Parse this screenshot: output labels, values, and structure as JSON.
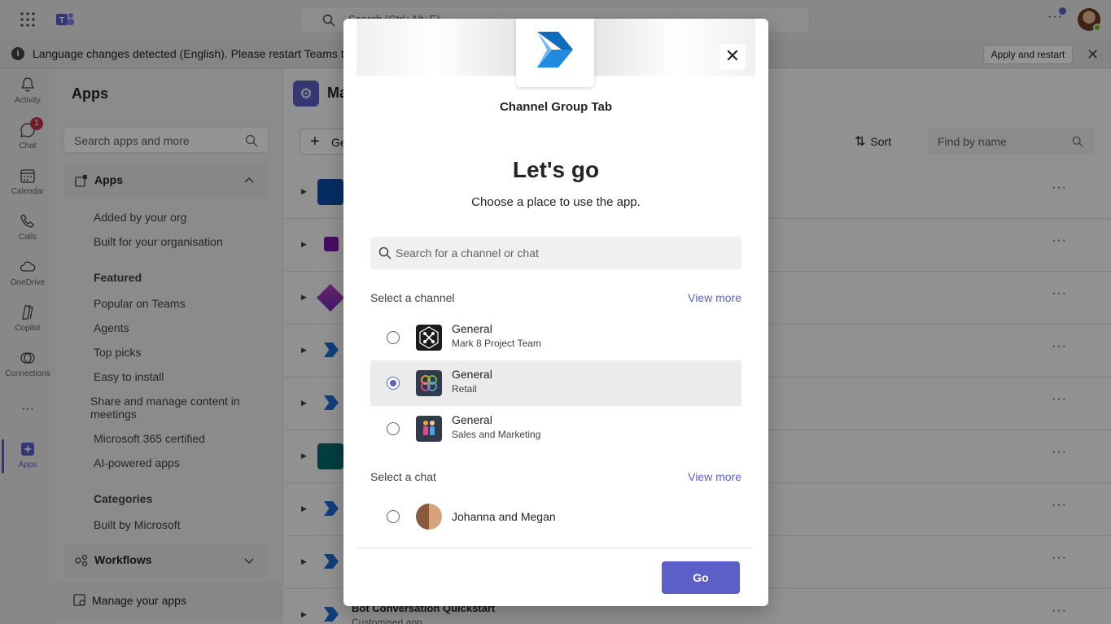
{
  "topbar": {
    "search_placeholder": "Search (Ctrl+Alt+E)",
    "more_label": "···"
  },
  "banner": {
    "text": "Language changes detected (English). Please restart Teams to",
    "apply_label": "Apply and restart",
    "close_label": "✕",
    "info_label": "i"
  },
  "rail": {
    "items": [
      {
        "label": "Activity",
        "icon": "bell-icon"
      },
      {
        "label": "Chat",
        "icon": "chat-icon",
        "badge": "1"
      },
      {
        "label": "Calendar",
        "icon": "calendar-icon"
      },
      {
        "label": "Calls",
        "icon": "phone-icon"
      },
      {
        "label": "OneDrive",
        "icon": "cloud-icon"
      },
      {
        "label": "Copilot",
        "icon": "copilot-icon"
      },
      {
        "label": "Connections",
        "icon": "connections-icon"
      },
      {
        "label": "···",
        "icon": "more-icon"
      },
      {
        "label": "Apps",
        "icon": "apps-icon"
      }
    ]
  },
  "left": {
    "title": "Apps",
    "search_placeholder": "Search apps and more",
    "apps_section": "Apps",
    "items": [
      "Added by your org",
      "Built for your organisation"
    ],
    "featured_head": "Featured",
    "featured": [
      "Popular on Teams",
      "Agents",
      "Top picks",
      "Easy to install",
      "Share and manage content in meetings",
      "Microsoft 365 certified",
      "AI-powered apps"
    ],
    "categories_head": "Categories",
    "categories": [
      "Built by Microsoft"
    ],
    "workflows_section": "Workflows",
    "manage_label": "Manage your apps"
  },
  "main": {
    "title": "Ma",
    "get_label": "Ge",
    "sort_label": "Sort",
    "find_placeholder": "Find by name",
    "bot_name": "Bot Conversation Quickstart",
    "bot_sub": "Customised app",
    "more_label": "···"
  },
  "dialog": {
    "app_name": "Channel Group Tab",
    "heading": "Let's go",
    "subheading": "Choose a place to use the app.",
    "search_placeholder": "Search for a channel or chat",
    "channel_label": "Select a channel",
    "chat_label": "Select a chat",
    "view_more": "View more",
    "close_label": "✕",
    "channels": [
      {
        "title": "General",
        "subtitle": "Mark 8 Project Team",
        "selected": false
      },
      {
        "title": "General",
        "subtitle": "Retail",
        "selected": true
      },
      {
        "title": "General",
        "subtitle": "Sales and Marketing",
        "selected": false
      }
    ],
    "chats": [
      {
        "title": "Johanna and Megan",
        "selected": false
      }
    ],
    "go_label": "Go"
  },
  "colors": {
    "accent": "#5b5fc7",
    "badge": "#c4314b"
  }
}
